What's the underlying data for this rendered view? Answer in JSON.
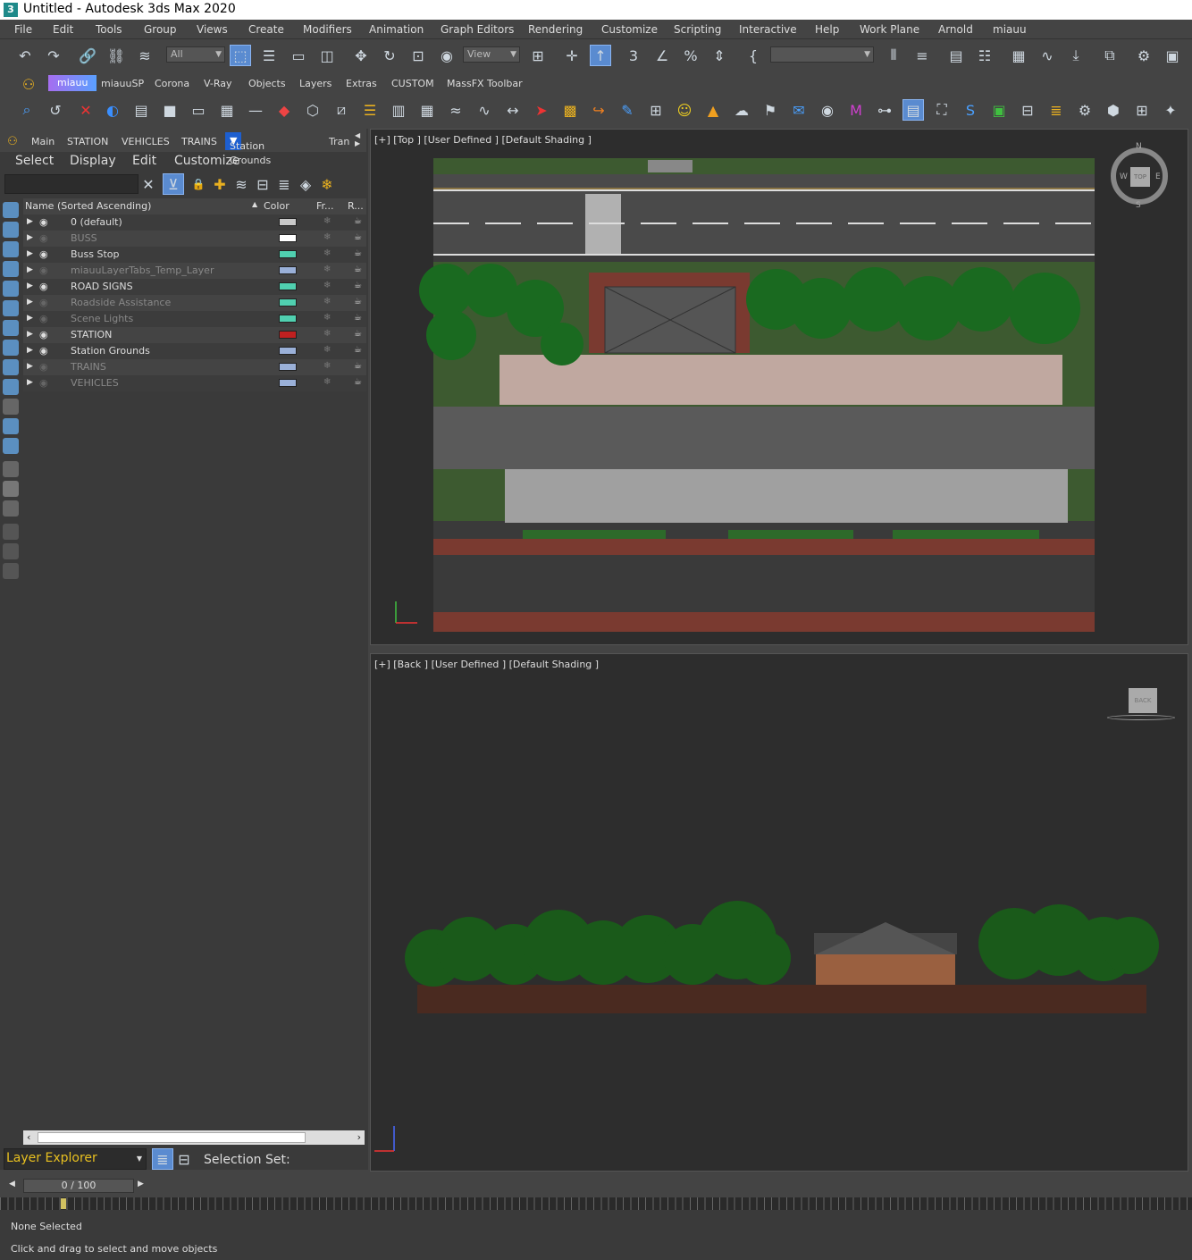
{
  "window": {
    "title": "Untitled - Autodesk 3ds Max 2020",
    "icon": "3"
  },
  "menu": [
    "File",
    "Edit",
    "Tools",
    "Group",
    "Views",
    "Create",
    "Modifiers",
    "Animation",
    "Graph Editors",
    "Rendering",
    "Customize",
    "Scripting",
    "Interactive",
    "Help",
    "Work Plane",
    "Arnold",
    "miauu"
  ],
  "toolbar": {
    "selection_filter": "All",
    "ref_coord": "View",
    "named_selection": ""
  },
  "ribbon_tabs": [
    "miauu",
    "miauuSP",
    "Corona",
    "V-Ray",
    "Objects",
    "Layers",
    "Extras",
    "CUSTOM",
    "MassFX Toolbar"
  ],
  "explorer": {
    "tabs": [
      "Main",
      "STATION",
      "VEHICLES",
      "TRAINS",
      "Station Grounds",
      "Tran"
    ],
    "active_tab": "Station Grounds",
    "menu": [
      "Select",
      "Display",
      "Edit",
      "Customize"
    ],
    "columns": {
      "name": "Name (Sorted Ascending)",
      "color": "Color",
      "freeze": "Fr...",
      "render": "R..."
    },
    "layers": [
      {
        "name": "0 (default)",
        "color": "#c8c8c8",
        "visible": true
      },
      {
        "name": "BUSS",
        "color": "#ffffff",
        "visible": false
      },
      {
        "name": "Buss Stop",
        "color": "#50d0b0",
        "visible": true
      },
      {
        "name": "miauuLayerTabs_Temp_Layer",
        "color": "#9ab0d8",
        "visible": false
      },
      {
        "name": "ROAD SIGNS",
        "color": "#50d0b0",
        "visible": true
      },
      {
        "name": "Roadside Assistance",
        "color": "#50d0b0",
        "visible": false
      },
      {
        "name": "Scene Lights",
        "color": "#50d0b0",
        "visible": false
      },
      {
        "name": "STATION",
        "color": "#c02020",
        "visible": true
      },
      {
        "name": "Station Grounds",
        "color": "#9ab0d8",
        "visible": true
      },
      {
        "name": "TRAINS",
        "color": "#9ab0d8",
        "visible": false
      },
      {
        "name": "VEHICLES",
        "color": "#9ab0d8",
        "visible": false
      }
    ],
    "footer_combo": "Layer Explorer",
    "selection_set_label": "Selection Set:"
  },
  "viewports": {
    "top_label": "[+] [Top ] [User Defined ] [Default Shading ]",
    "back_label": "[+] [Back ] [User Defined ] [Default Shading ]",
    "viewcube_top": "TOP",
    "viewcube_back": "BACK",
    "compass": {
      "n": "N",
      "s": "S",
      "e": "E",
      "w": "W"
    }
  },
  "timeline": {
    "frame": "0 / 100"
  },
  "status": {
    "line1": "None Selected",
    "line2": "Click and drag to select and move objects"
  }
}
